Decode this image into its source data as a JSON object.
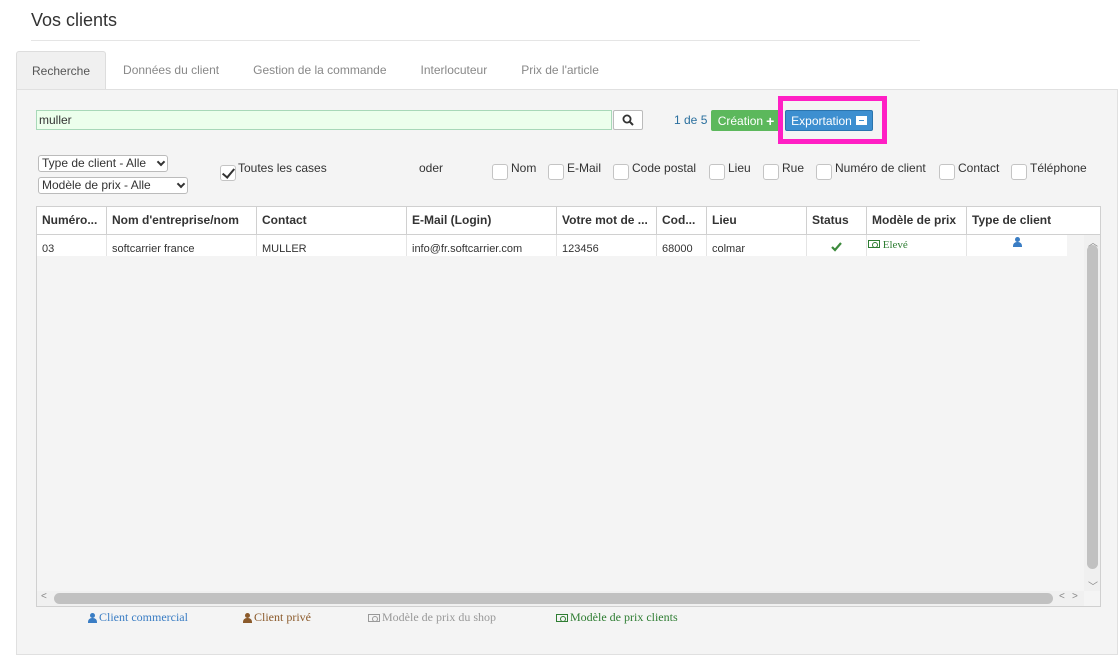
{
  "page": {
    "title": "Vos clients"
  },
  "tabs": [
    {
      "label": "Recherche"
    },
    {
      "label": "Données du client"
    },
    {
      "label": "Gestion de la commande"
    },
    {
      "label": "Interlocuteur"
    },
    {
      "label": "Prix de l'article"
    }
  ],
  "search": {
    "value": "muller",
    "placeholder": ""
  },
  "pagination": {
    "label": "1 de 5"
  },
  "toolbar": {
    "create_label": "Création",
    "export_label": "Exportation"
  },
  "filters": {
    "client_type": "Type de client - Alle",
    "price_model": "Modèle de prix - Alle",
    "all_label": "Toutes les cases",
    "or_label": "oder",
    "fields": [
      "Nom",
      "E-Mail",
      "Code postal",
      "Lieu",
      "Rue",
      "Numéro de client",
      "Contact",
      "Téléphone"
    ]
  },
  "table": {
    "columns": [
      "Numéro...",
      "Nom d'entreprise/nom",
      "Contact",
      "E-Mail (Login)",
      "Votre mot de ...",
      "Cod...",
      "Lieu",
      "Status",
      "Modèle de prix",
      "Type de client"
    ],
    "rows": [
      {
        "number": "03",
        "company": "softcarrier france",
        "contact": "MULLER",
        "email": "info@fr.softcarrier.com",
        "password": "123456",
        "postal_code": "68000",
        "city": "colmar",
        "status_icon": "check-icon",
        "price_model": "Elevé",
        "client_type_icon": "user-icon"
      }
    ]
  },
  "legend": {
    "items": [
      {
        "label": "Client commercial",
        "icon": "user-icon",
        "color": "#3a7dc4"
      },
      {
        "label": "Client privé",
        "icon": "user-icon",
        "color": "#8b5a2b"
      },
      {
        "label": "Modèle de prix du shop",
        "icon": "money-icon",
        "color": "#999999"
      },
      {
        "label": "Modèle de prix clients",
        "icon": "money-icon",
        "color": "#2e7d32"
      }
    ]
  },
  "colors": {
    "accent_green": "#5cb85c",
    "accent_blue": "#3d8fd0",
    "highlight": "#ff1fc4"
  }
}
